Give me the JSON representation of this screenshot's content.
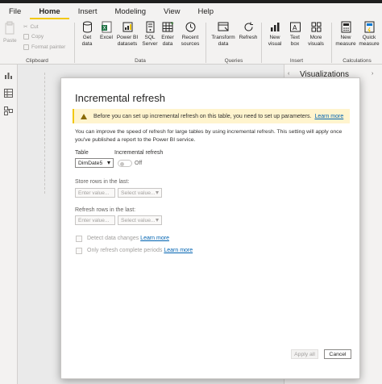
{
  "menu": {
    "tabs": [
      "File",
      "Home",
      "Insert",
      "Modeling",
      "View",
      "Help"
    ],
    "active": "Home"
  },
  "ribbon": {
    "clipboard": {
      "paste": "Paste",
      "cut": "Cut",
      "copy": "Copy",
      "format_painter": "Format painter",
      "label": "Clipboard"
    },
    "data": {
      "get_data": "Get data",
      "excel": "Excel",
      "power_bi": "Power BI datasets",
      "sql": "SQL Server",
      "enter": "Enter data",
      "recent": "Recent sources",
      "label": "Data"
    },
    "queries": {
      "transform": "Transform data",
      "refresh": "Refresh",
      "label": "Queries"
    },
    "insert": {
      "new_visual": "New visual",
      "text_box": "Text box",
      "more_visuals": "More visuals",
      "label": "Insert"
    },
    "calculations": {
      "new_measure": "New measure",
      "quick_measure": "Quick measure",
      "label": "Calculations"
    }
  },
  "right_pane": {
    "title": "Visualizations"
  },
  "dialog": {
    "title": "Incremental refresh",
    "warning_text": "Before you can set up incremental refresh on this table, you need to set up parameters.",
    "warning_link": "Learn more",
    "description": "You can improve the speed of refresh for large tables by using incremental refresh. This setting will apply once you've published a report to the Power BI service.",
    "table_label": "Table",
    "table_value": "DimDate5",
    "incremental_label": "Incremental refresh",
    "toggle_state": "Off",
    "store_label": "Store rows in the last:",
    "store_value_placeholder": "Enter value...",
    "store_unit_placeholder": "Select value...",
    "refresh_label": "Refresh rows in the last:",
    "refresh_value_placeholder": "Enter value...",
    "refresh_unit_placeholder": "Select value...",
    "detect_changes": "Detect data changes",
    "detect_link": "Learn more",
    "complete_periods": "Only refresh complete periods",
    "complete_link": "Learn more",
    "apply_all": "Apply all",
    "cancel": "Cancel"
  }
}
